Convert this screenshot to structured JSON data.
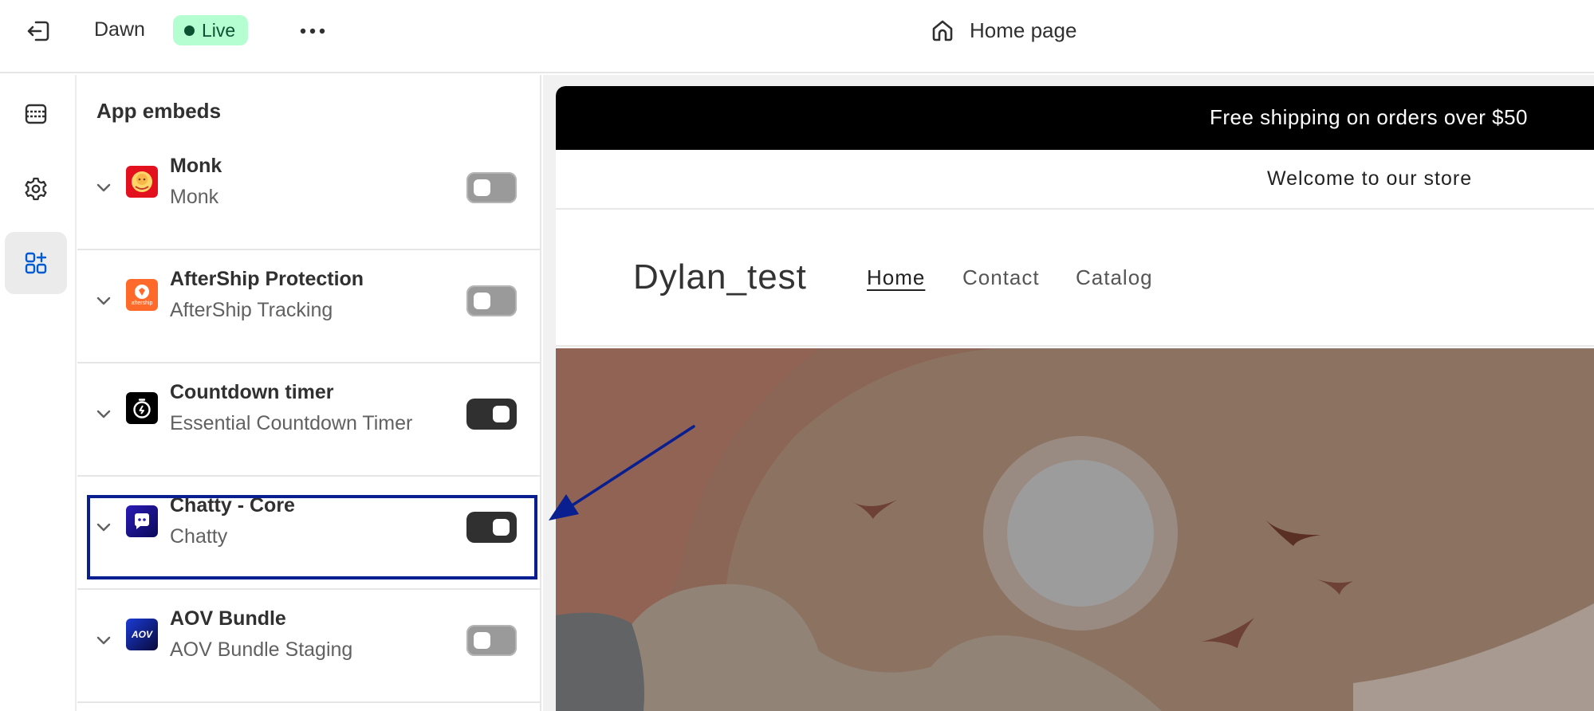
{
  "topbar": {
    "theme_name": "Dawn",
    "status_label": "Live",
    "page_label": "Home page",
    "status_color": "#b4fed2"
  },
  "rail": {
    "items": [
      {
        "icon": "sections-icon",
        "active": false
      },
      {
        "icon": "gear-icon",
        "active": false
      },
      {
        "icon": "app-embeds-icon",
        "active": true
      }
    ]
  },
  "panel": {
    "title": "App embeds",
    "embeds": [
      {
        "title": "Monk",
        "subtitle": "Monk",
        "enabled": false,
        "icon": "monk-app-icon"
      },
      {
        "title": "AfterShip Protection",
        "subtitle": "AfterShip Tracking",
        "enabled": false,
        "icon": "aftership-app-icon",
        "icon_text": "aftership"
      },
      {
        "title": "Countdown timer",
        "subtitle": "Essential Countdown Timer",
        "enabled": true,
        "icon": "timer-app-icon"
      },
      {
        "title": "Chatty - Core",
        "subtitle": "Chatty",
        "enabled": true,
        "icon": "chatty-app-icon"
      },
      {
        "title": "AOV Bundle",
        "subtitle": "AOV Bundle Staging",
        "enabled": false,
        "icon": "aov-app-icon",
        "icon_text": "AOV"
      }
    ]
  },
  "preview": {
    "announcement": "Free shipping on orders over $50",
    "welcome": "Welcome to our store",
    "store_name": "Dylan_test",
    "nav": [
      "Home",
      "Contact",
      "Catalog"
    ]
  },
  "annotation": {
    "highlight_color": "#0a1f8f"
  }
}
